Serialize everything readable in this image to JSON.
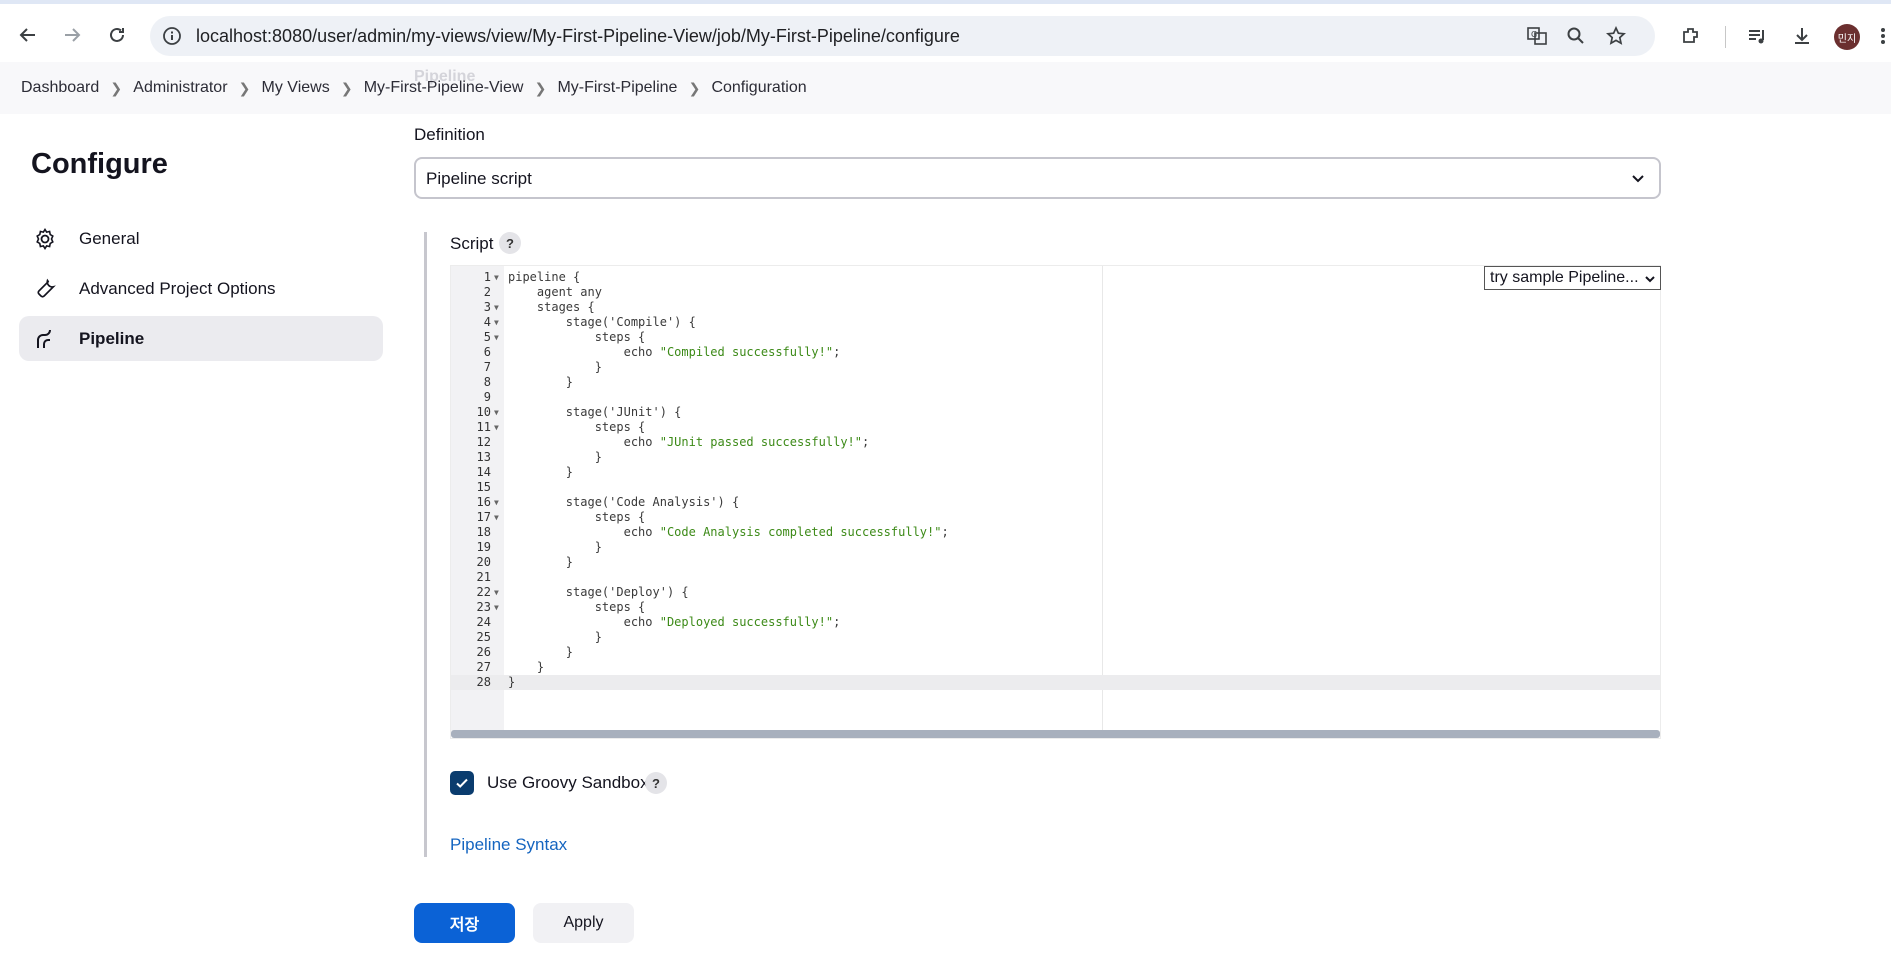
{
  "browser": {
    "url": "localhost:8080/user/admin/my-views/view/My-First-Pipeline-View/job/My-First-Pipeline/configure",
    "profile_initials": "민지"
  },
  "breadcrumb": {
    "ghost_title": "Pipeline",
    "items": [
      {
        "label": "Dashboard"
      },
      {
        "label": "Administrator"
      },
      {
        "label": "My Views"
      },
      {
        "label": "My-First-Pipeline-View"
      },
      {
        "label": "My-First-Pipeline"
      },
      {
        "label": "Configuration"
      }
    ]
  },
  "sidebar": {
    "title": "Configure",
    "items": [
      {
        "label": "General",
        "icon": "gear-icon"
      },
      {
        "label": "Advanced Project Options",
        "icon": "wrench-icon"
      },
      {
        "label": "Pipeline",
        "icon": "pipeline-icon",
        "active": true
      }
    ]
  },
  "definition": {
    "label": "Definition",
    "selected": "Pipeline script"
  },
  "script": {
    "label": "Script",
    "help": "?",
    "sample_select": "try sample Pipeline...",
    "current_line": 28,
    "lines": [
      {
        "n": "1",
        "text": "pipeline {",
        "fold": true
      },
      {
        "n": "2",
        "text": "    agent any",
        "fold": false
      },
      {
        "n": "3",
        "text": "    stages {",
        "fold": true
      },
      {
        "n": "4",
        "text": "        stage('Compile') {",
        "fold": true
      },
      {
        "n": "5",
        "text": "            steps {",
        "fold": true
      },
      {
        "n": "6",
        "text": "                echo \"Compiled successfully!\";",
        "fold": false
      },
      {
        "n": "7",
        "text": "            }",
        "fold": false
      },
      {
        "n": "8",
        "text": "        }",
        "fold": false
      },
      {
        "n": "9",
        "text": "",
        "fold": false
      },
      {
        "n": "10",
        "text": "        stage('JUnit') {",
        "fold": true
      },
      {
        "n": "11",
        "text": "            steps {",
        "fold": true
      },
      {
        "n": "12",
        "text": "                echo \"JUnit passed successfully!\";",
        "fold": false
      },
      {
        "n": "13",
        "text": "            }",
        "fold": false
      },
      {
        "n": "14",
        "text": "        }",
        "fold": false
      },
      {
        "n": "15",
        "text": "",
        "fold": false
      },
      {
        "n": "16",
        "text": "        stage('Code Analysis') {",
        "fold": true
      },
      {
        "n": "17",
        "text": "            steps {",
        "fold": true
      },
      {
        "n": "18",
        "text": "                echo \"Code Analysis completed successfully!\";",
        "fold": false
      },
      {
        "n": "19",
        "text": "            }",
        "fold": false
      },
      {
        "n": "20",
        "text": "        }",
        "fold": false
      },
      {
        "n": "21",
        "text": "",
        "fold": false
      },
      {
        "n": "22",
        "text": "        stage('Deploy') {",
        "fold": true
      },
      {
        "n": "23",
        "text": "            steps {",
        "fold": true
      },
      {
        "n": "24",
        "text": "                echo \"Deployed successfully!\";",
        "fold": false
      },
      {
        "n": "25",
        "text": "            }",
        "fold": false
      },
      {
        "n": "26",
        "text": "        }",
        "fold": false
      },
      {
        "n": "27",
        "text": "    }",
        "fold": false
      },
      {
        "n": "28",
        "text": "}",
        "fold": false
      }
    ]
  },
  "sandbox": {
    "label": "Use Groovy Sandbox",
    "checked": true,
    "help": "?"
  },
  "links": {
    "pipeline_syntax": "Pipeline Syntax"
  },
  "buttons": {
    "save": "저장",
    "apply": "Apply"
  },
  "colors": {
    "primary": "#0b62d6",
    "checkbox": "#0a3c6e",
    "link": "#1565c0",
    "string": "#3c8a17"
  }
}
